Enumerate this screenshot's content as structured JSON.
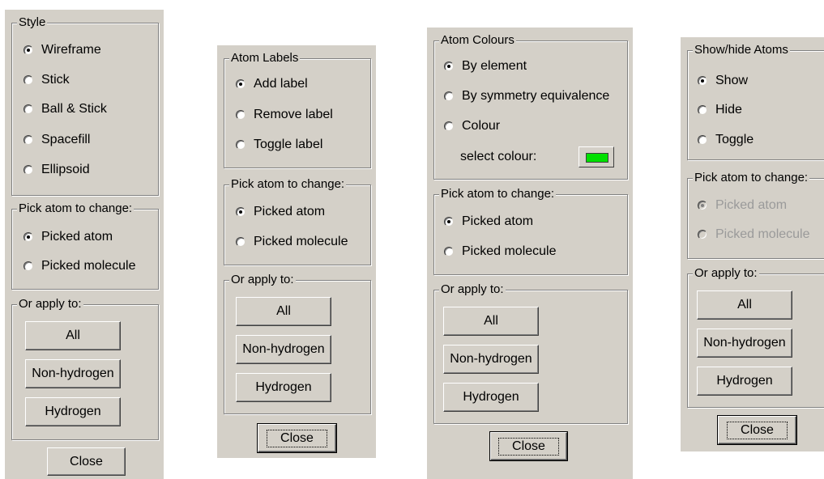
{
  "panel1": {
    "style_group": {
      "legend": "Style",
      "options": [
        {
          "label": "Wireframe",
          "checked": true
        },
        {
          "label": "Stick",
          "checked": false
        },
        {
          "label": "Ball & Stick",
          "checked": false
        },
        {
          "label": "Spacefill",
          "checked": false
        },
        {
          "label": "Ellipsoid",
          "checked": false
        }
      ]
    },
    "pick_group": {
      "legend": "Pick atom to change:",
      "options": [
        {
          "label": "Picked atom",
          "checked": true
        },
        {
          "label": "Picked molecule",
          "checked": false
        }
      ]
    },
    "apply_group": {
      "legend": "Or apply to:",
      "buttons": [
        "All",
        "Non-hydrogen",
        "Hydrogen"
      ]
    },
    "close_label": "Close"
  },
  "panel2": {
    "labels_group": {
      "legend": "Atom Labels",
      "options": [
        {
          "label": "Add label",
          "checked": true
        },
        {
          "label": "Remove label",
          "checked": false
        },
        {
          "label": "Toggle label",
          "checked": false
        }
      ]
    },
    "pick_group": {
      "legend": "Pick atom to change:",
      "options": [
        {
          "label": "Picked atom",
          "checked": true
        },
        {
          "label": "Picked molecule",
          "checked": false
        }
      ]
    },
    "apply_group": {
      "legend": "Or apply to:",
      "buttons": [
        "All",
        "Non-hydrogen",
        "Hydrogen"
      ]
    },
    "close_label": "Close"
  },
  "panel3": {
    "colours_group": {
      "legend": "Atom Colours",
      "options": [
        {
          "label": "By element",
          "checked": true
        },
        {
          "label": "By symmetry equivalence",
          "checked": false
        },
        {
          "label": "Colour",
          "checked": false
        }
      ],
      "select_colour_label": "select colour:",
      "swatch_color": "#00e000"
    },
    "pick_group": {
      "legend": "Pick atom to change:",
      "options": [
        {
          "label": "Picked atom",
          "checked": true
        },
        {
          "label": "Picked molecule",
          "checked": false
        }
      ]
    },
    "apply_group": {
      "legend": "Or apply to:",
      "buttons": [
        "All",
        "Non-hydrogen",
        "Hydrogen"
      ]
    },
    "close_label": "Close"
  },
  "panel4": {
    "showhide_group": {
      "legend": "Show/hide Atoms",
      "options": [
        {
          "label": "Show",
          "checked": true
        },
        {
          "label": "Hide",
          "checked": false
        },
        {
          "label": "Toggle",
          "checked": false
        }
      ]
    },
    "pick_group": {
      "legend": "Pick atom to change:",
      "disabled": true,
      "options": [
        {
          "label": "Picked atom",
          "checked": true
        },
        {
          "label": "Picked molecule",
          "checked": false
        }
      ]
    },
    "apply_group": {
      "legend": "Or apply to:",
      "buttons": [
        "All",
        "Non-hydrogen",
        "Hydrogen"
      ]
    },
    "close_label": "Close"
  }
}
